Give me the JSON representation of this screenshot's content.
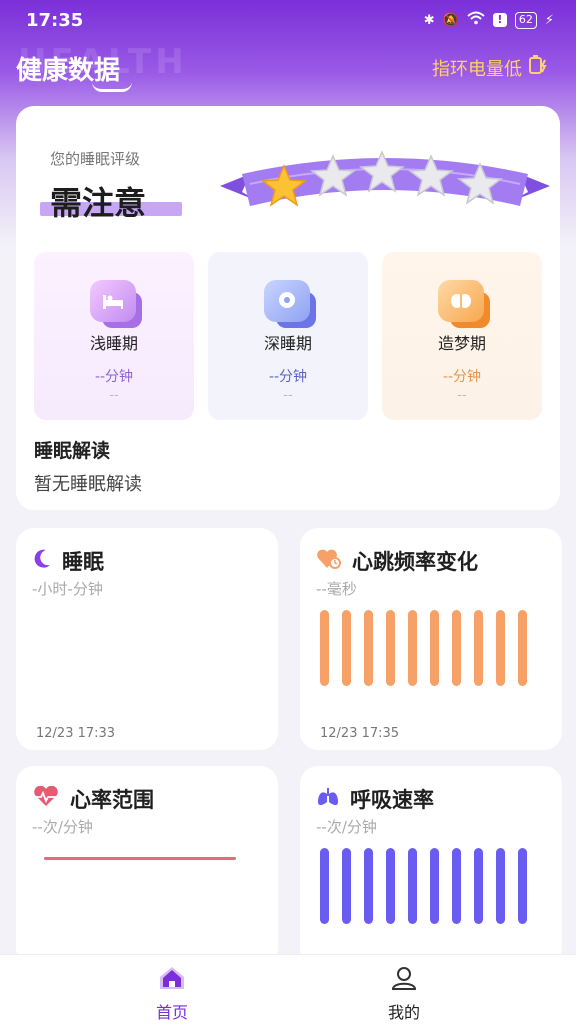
{
  "status": {
    "time": "17:35",
    "battery": "62"
  },
  "header": {
    "watermark": "HEALTH",
    "title": "健康数据",
    "ring_alert": "指环电量低"
  },
  "sleep_rating": {
    "label": "您的睡眠评级",
    "value": "需注意",
    "stars_filled": 1,
    "stars_total": 5
  },
  "stages": [
    {
      "name": "浅睡期",
      "value": "--分钟",
      "sub": "--",
      "color": "#8e62d6"
    },
    {
      "name": "深睡期",
      "value": "--分钟",
      "sub": "--",
      "color": "#5d63c9"
    },
    {
      "name": "造梦期",
      "value": "--分钟",
      "sub": "--",
      "color": "#e8954a"
    }
  ],
  "interpretation": {
    "title": "睡眠解读",
    "text": "暂无睡眠解读"
  },
  "cards": {
    "sleep": {
      "title": "睡眠",
      "sub": "-小时-分钟",
      "time": "12/23 17:33",
      "icon": "moon-icon"
    },
    "hrv": {
      "title": "心跳频率变化",
      "sub": "--毫秒",
      "time": "12/23 17:35",
      "icon": "heart-clock-icon",
      "bar_color": "#f5a167"
    },
    "hr_range": {
      "title": "心率范围",
      "sub": "--次/分钟",
      "icon": "heart-pulse-icon",
      "line_color": "#e46a7e"
    },
    "resp": {
      "title": "呼吸速率",
      "sub": "--次/分钟",
      "icon": "lungs-icon",
      "bar_color": "#6a5cf0"
    }
  },
  "nav": [
    {
      "label": "首页",
      "icon": "home-icon",
      "active": true
    },
    {
      "label": "我的",
      "icon": "user-icon",
      "active": false
    }
  ]
}
